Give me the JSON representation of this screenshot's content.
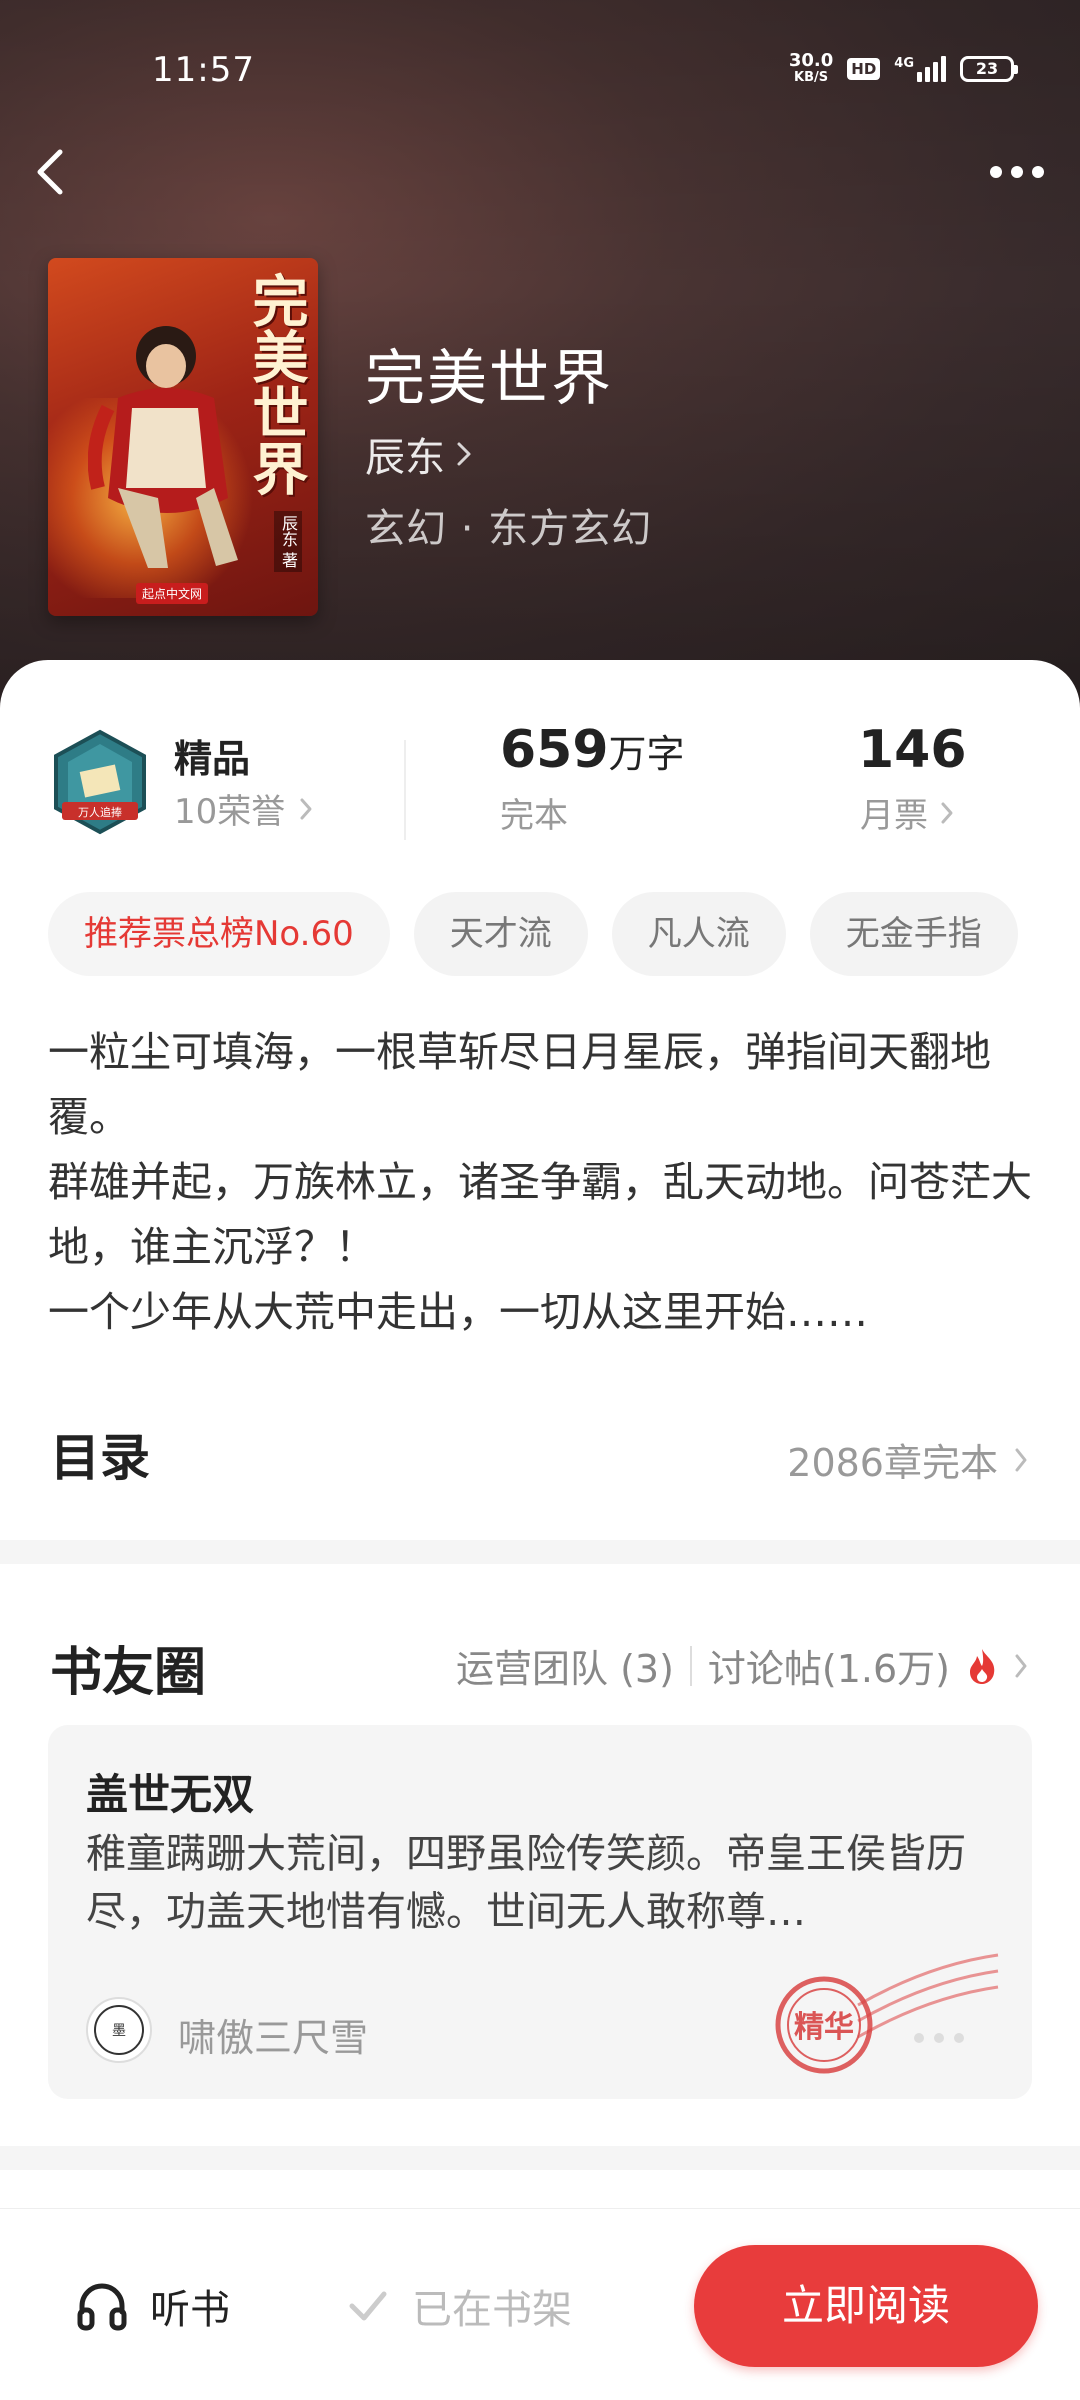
{
  "status_bar": {
    "time": "11:57",
    "net_speed": "30.0",
    "net_unit": "KB/S",
    "hd": "HD",
    "network": "4G",
    "battery": "23"
  },
  "book": {
    "title": "完美世界",
    "author": "辰东",
    "genre": "玄幻 · 东方玄幻",
    "cover_title": "完美世界",
    "cover_author": "辰东 著",
    "cover_publisher": "起点中文网"
  },
  "stats": {
    "honor_title": "精品",
    "honor_count": "10荣誉",
    "badge_text": "万人追捧",
    "word_count": "659",
    "word_unit": "万字",
    "status": "完本",
    "monthly_votes": "146",
    "monthly_votes_label": "月票"
  },
  "tags": [
    "推荐票总榜No.60",
    "天才流",
    "凡人流",
    "无金手指"
  ],
  "intro": [
    "一粒尘可填海，一根草斩尽日月星辰，弹指间天翻地覆。",
    "群雄并起，万族林立，诸圣争霸，乱天动地。问苍茫大地，谁主沉浮？！",
    "一个少年从大荒中走出，一切从这里开始……"
  ],
  "toc": {
    "title": "目录",
    "meta": "2086章完本"
  },
  "circle": {
    "title": "书友圈",
    "team": "运营团队 (3)",
    "discussion": "讨论帖(1.6万)",
    "post": {
      "title": "盖世无双",
      "body": "稚童蹒跚大荒间，四野虽险传笑颜。帝皇王侯皆历尽，功盖天地惜有憾。世间无人敢称尊…",
      "user": "啸傲三尺雪",
      "stamp": "精华"
    }
  },
  "bottom": {
    "listen": "听书",
    "shelf": "已在书架",
    "read": "立即阅读"
  },
  "colors": {
    "accent": "#e83c3c",
    "hero_bg": "#3a2c2d"
  }
}
